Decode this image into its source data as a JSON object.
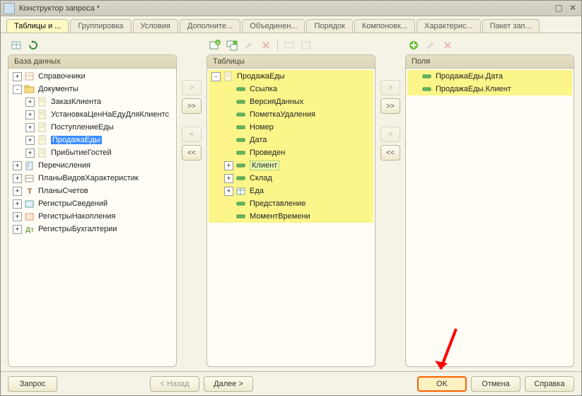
{
  "window": {
    "title": "Конструктор запроса *"
  },
  "tabs": [
    {
      "label": "Таблицы и ...",
      "active": true
    },
    {
      "label": "Группировка"
    },
    {
      "label": "Условия"
    },
    {
      "label": "Дополните..."
    },
    {
      "label": "Объединен..."
    },
    {
      "label": "Порядок"
    },
    {
      "label": "Компоновк..."
    },
    {
      "label": "Характерис..."
    },
    {
      "label": "Пакет зап..."
    }
  ],
  "panels": {
    "database": {
      "title": "База данных",
      "nodes": [
        {
          "label": "Справочники",
          "exp": "+",
          "depth": 0,
          "icon": "catalog"
        },
        {
          "label": "Документы",
          "exp": "-",
          "depth": 0,
          "icon": "folder"
        },
        {
          "label": "ЗаказКлиента",
          "exp": "+",
          "depth": 1,
          "icon": "doc"
        },
        {
          "label": "УстановкаЦенНаЕдуДляКлиентс",
          "exp": "+",
          "depth": 1,
          "icon": "doc"
        },
        {
          "label": "ПоступлениеЕды",
          "exp": "+",
          "depth": 1,
          "icon": "doc"
        },
        {
          "label": "ПродажаЕды",
          "exp": "+",
          "depth": 1,
          "icon": "doc",
          "sel": true
        },
        {
          "label": "ПрибытиеГостей",
          "exp": "+",
          "depth": 1,
          "icon": "doc"
        },
        {
          "label": "Перечисления",
          "exp": "+",
          "depth": 0,
          "icon": "enum"
        },
        {
          "label": "ПланыВидовХарактеристик",
          "exp": "+",
          "depth": 0,
          "icon": "cchar"
        },
        {
          "label": "ПланыСчетов",
          "exp": "+",
          "depth": 0,
          "icon": "accounts"
        },
        {
          "label": "РегистрыСведений",
          "exp": "+",
          "depth": 0,
          "icon": "reginfo"
        },
        {
          "label": "РегистрыНакопления",
          "exp": "+",
          "depth": 0,
          "icon": "regacc"
        },
        {
          "label": "РегистрыБухгалтерии",
          "exp": "+",
          "depth": 0,
          "icon": "regbook"
        }
      ]
    },
    "tables": {
      "title": "Таблицы",
      "nodes": [
        {
          "label": "ПродажаЕды",
          "exp": "-",
          "depth": 0,
          "icon": "doc",
          "hl": true
        },
        {
          "label": "Ссылка",
          "exp": "",
          "depth": 1,
          "icon": "field",
          "hl": true
        },
        {
          "label": "ВерсияДанных",
          "exp": "",
          "depth": 1,
          "icon": "field",
          "hl": true
        },
        {
          "label": "ПометкаУдаления",
          "exp": "",
          "depth": 1,
          "icon": "field",
          "hl": true
        },
        {
          "label": "Номер",
          "exp": "",
          "depth": 1,
          "icon": "field",
          "hl": true
        },
        {
          "label": "Дата",
          "exp": "",
          "depth": 1,
          "icon": "field",
          "hl": true
        },
        {
          "label": "Проведен",
          "exp": "",
          "depth": 1,
          "icon": "field",
          "hl": true
        },
        {
          "label": "Клиент",
          "exp": "+",
          "depth": 1,
          "icon": "field",
          "hl": true,
          "selgreen": true
        },
        {
          "label": "Склад",
          "exp": "+",
          "depth": 1,
          "icon": "field",
          "hl": true
        },
        {
          "label": "Еда",
          "exp": "+",
          "depth": 1,
          "icon": "tabpart",
          "hl": true
        },
        {
          "label": "Представление",
          "exp": "",
          "depth": 1,
          "icon": "field",
          "hl": true
        },
        {
          "label": "МоментВремени",
          "exp": "",
          "depth": 1,
          "icon": "field",
          "hl": true
        }
      ]
    },
    "fields": {
      "title": "Поля",
      "nodes": [
        {
          "label": "ПродажаЕды.Дата",
          "exp": "",
          "depth": 0,
          "icon": "field",
          "hl": true
        },
        {
          "label": "ПродажаЕды.Клиент",
          "exp": "",
          "depth": 0,
          "icon": "field",
          "hl": true
        }
      ]
    }
  },
  "buttons": {
    "query": "Запрос",
    "back": "< Назад",
    "next": "Далее >",
    "ok": "OK",
    "cancel": "Отмена",
    "help": "Справка"
  }
}
